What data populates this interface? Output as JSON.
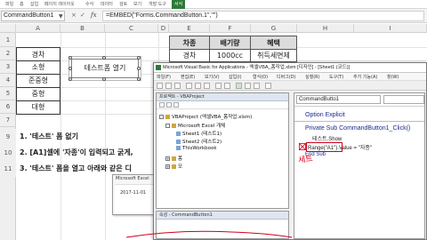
{
  "ribbon": {
    "tabs": [
      "파일",
      "홈",
      "삽입",
      "페이지 레이아웃",
      "수식",
      "데이터",
      "검토",
      "보기",
      "개발 도구",
      "서식"
    ],
    "active_tab": "서식",
    "accent": "#2b7a38"
  },
  "formula_bar": {
    "name_box": "CommandButton1",
    "cancel": "×",
    "enter": "✓",
    "fx": "fx",
    "formula": "=EMBED(\"Forms.CommandButton.1\",\"\")"
  },
  "columns": [
    "A",
    "B",
    "C",
    "D",
    "E",
    "F",
    "G",
    "H",
    "I"
  ],
  "rows": [
    "1",
    "2",
    "3",
    "4",
    "5",
    "6",
    "7",
    "8",
    "9",
    "10",
    "11",
    "12",
    "13",
    "14",
    "15"
  ],
  "sheet": {
    "col_a": [
      "경차",
      "소형",
      "준중형",
      "중형",
      "대형"
    ],
    "button_label": "테스트폼 열기",
    "table": {
      "headers": [
        "차종",
        "배기량",
        "혜택"
      ],
      "row": [
        "경차",
        "1000cc",
        "취득세면제"
      ]
    },
    "instructions": {
      "line1": "1. '테스트' 폼 없기",
      "line2": "2. [A1]셀에 '자종'이 입력되고 굵게,",
      "line3": "3. '테스트' 폼을 열고 아래와 같은 디"
    },
    "instr_row_nums": [
      "9",
      "10",
      "11"
    ]
  },
  "msgbox": {
    "title": "Microsoft Excel",
    "body": "2017-11-01",
    "close": "×"
  },
  "vbe": {
    "title": "Microsoft Visual Basic for Applications - 엑셀VBA_폼작업.xlsm [디자인] - [Sheet1 (코드)]",
    "menu": [
      "파일(F)",
      "편집(E)",
      "보기(V)",
      "삽입(I)",
      "형식(O)",
      "디버그(D)",
      "실행(R)",
      "도구(T)",
      "추가 기능(A)",
      "창(W)"
    ],
    "project_pane_title": "프로젝트 - VBAProject",
    "project_tree": {
      "root": "VBAProject (엑셀VBA_폼작업.xlsm)",
      "folder": "Microsoft Excel 개체",
      "sheet1": "Sheet1 (테스트1)",
      "sheet2": "Sheet2 (테스트2)",
      "workbook": "ThisWorkbook",
      "forms_folder": "폼",
      "module": "모"
    },
    "properties_title": "속성 - CommandButton1",
    "object_combo": "CommandButto1",
    "code": {
      "option": "Option Explicit",
      "sub": "Private Sub CommandButton1_Click()",
      "show": "테스트.Show",
      "range_highlight": "Range(\"A1\")",
      "value": ".Value = \"자종\"",
      "end_sub": "End Sub"
    },
    "annotation": "세트"
  }
}
